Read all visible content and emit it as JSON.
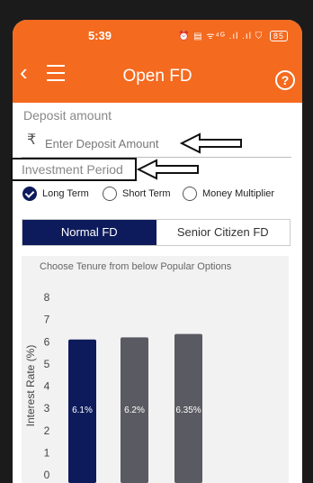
{
  "status_bar": {
    "time": "5:39",
    "icons_text": "⏰ ▤ ᯤ⁴ᴳ .ıl .ıl ⛉",
    "battery": "85"
  },
  "app_bar": {
    "back_glyph": "‹",
    "title": "Open FD",
    "help_glyph": "?"
  },
  "deposit": {
    "label": "Deposit amount",
    "currency": "₹",
    "placeholder": "Enter Deposit Amount"
  },
  "investment_period": {
    "label": "Investment Period",
    "options": [
      {
        "label": "Long Term",
        "selected": true
      },
      {
        "label": "Short Term",
        "selected": false
      },
      {
        "label": "Money Multiplier",
        "selected": false
      }
    ]
  },
  "fd_tabs": [
    {
      "label": "Normal FD",
      "active": true
    },
    {
      "label": "Senior Citizen FD",
      "active": false
    }
  ],
  "chart_title": "Choose Tenure from below Popular Options",
  "chart_data": {
    "type": "bar",
    "ylabel": "Interest Rate (%)",
    "ylim": [
      0,
      8
    ],
    "yticks": [
      "0",
      "1",
      "2",
      "3",
      "4",
      "5",
      "6",
      "7",
      "8"
    ],
    "values": [
      6.1,
      6.2,
      6.35
    ],
    "labels": [
      "6.1%",
      "6.2%",
      "6.35%"
    ],
    "colors": [
      "#0d1b5c",
      "#5a5a62",
      "#5a5a62"
    ]
  }
}
